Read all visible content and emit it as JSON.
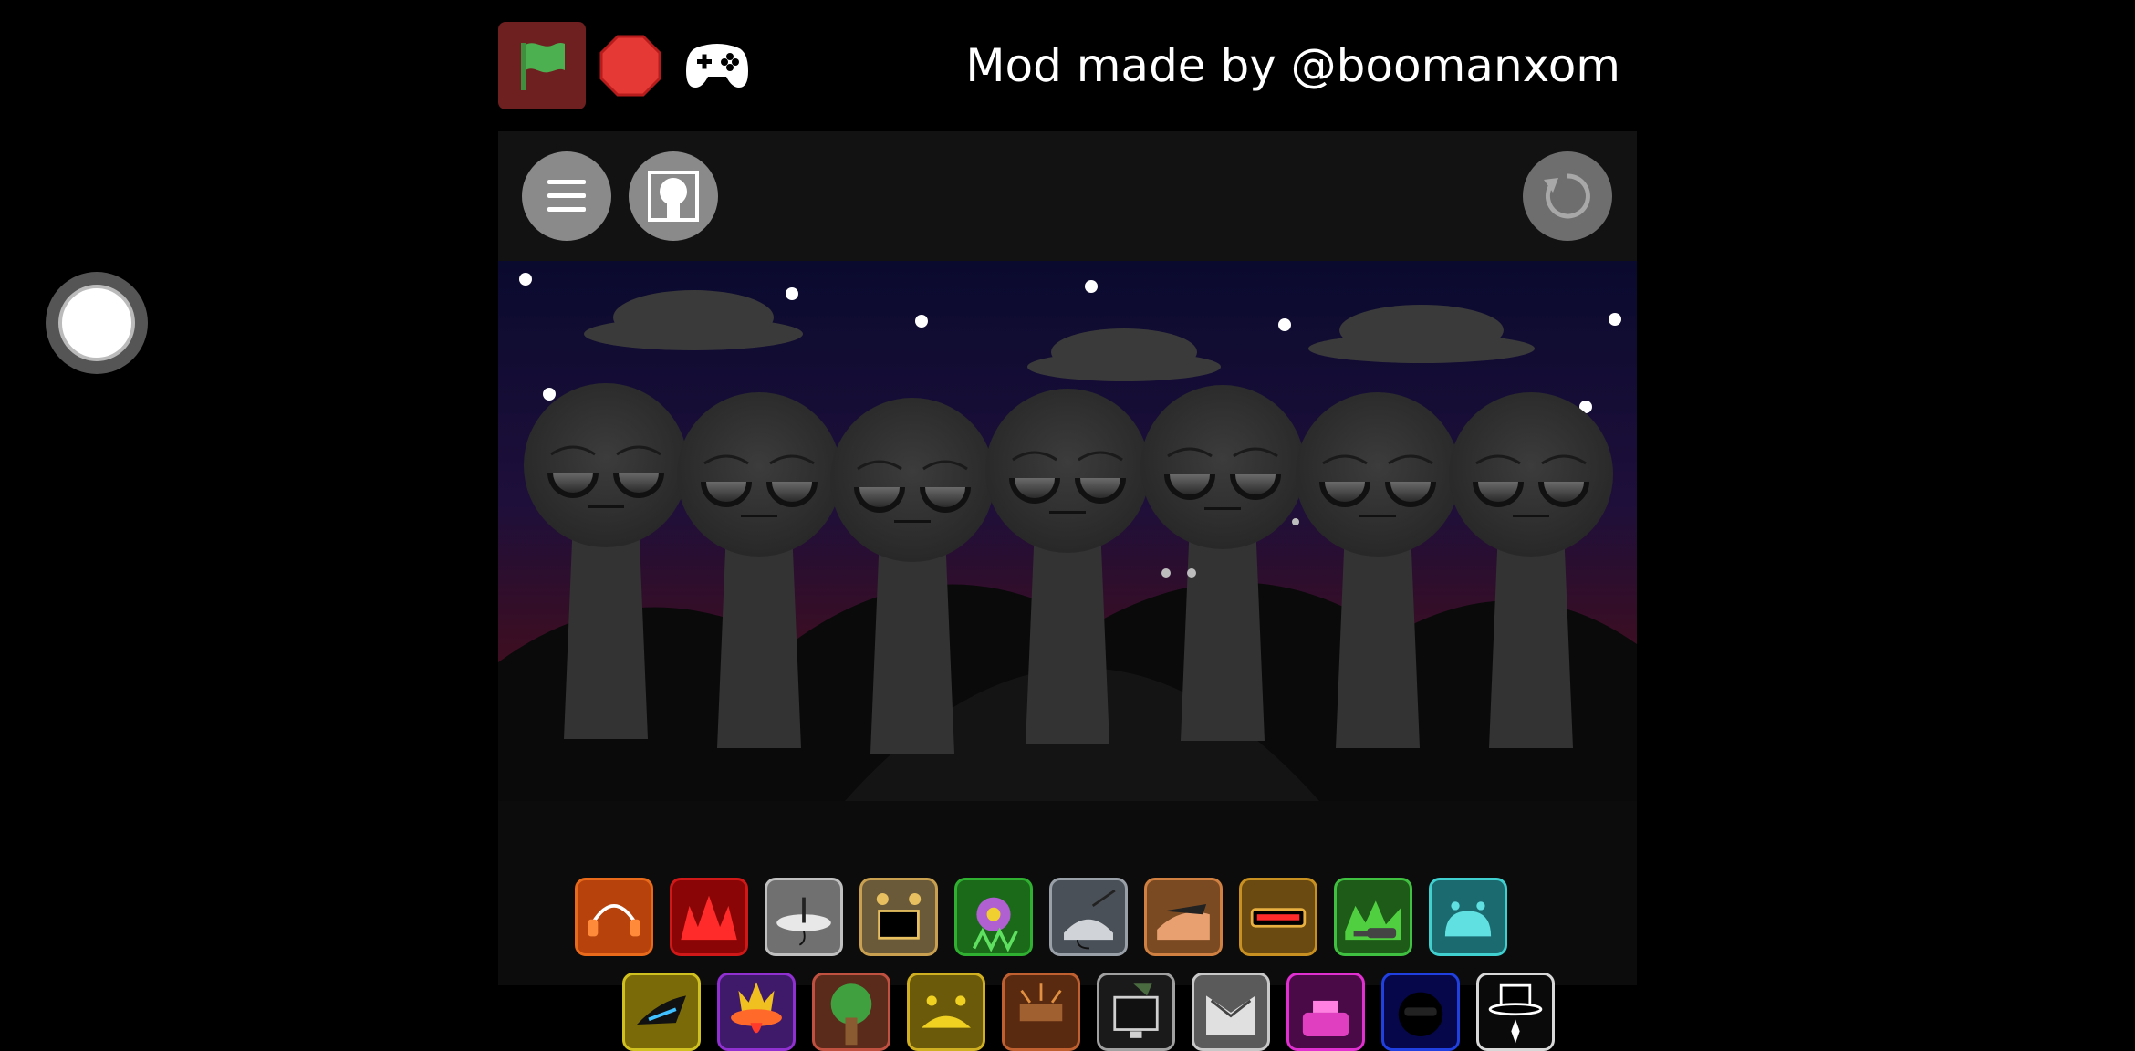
{
  "header": {
    "credit": "Mod made by @boomanxom"
  },
  "icons": {
    "flag": "green-flag-icon",
    "stop": "stop-sign-icon",
    "gamepad": "gamepad-icon",
    "menu": "hamburger-menu-icon",
    "character": "character-select-icon",
    "reset": "reset-icon"
  },
  "colors": {
    "flag_bg": "#6e1f1f",
    "flag": "#4caf50",
    "stop": "#e53935",
    "sky_top": "#0a0a2e",
    "sky_bottom": "#4a0d16"
  },
  "palette_row1": [
    {
      "id": "orange-headphones",
      "border": "#e86a1a",
      "bg": "#b8420c"
    },
    {
      "id": "red-spikes",
      "border": "#d01818",
      "bg": "#8a0606"
    },
    {
      "id": "silver-disc",
      "border": "#c0c0c0",
      "bg": "#707070"
    },
    {
      "id": "gold-monitor",
      "border": "#c8a050",
      "bg": "#6a5a3a"
    },
    {
      "id": "green-flower",
      "border": "#30b030",
      "bg": "#1a6a1a"
    },
    {
      "id": "gray-cat",
      "border": "#9aa0a8",
      "bg": "#4a5058"
    },
    {
      "id": "orange-cap",
      "border": "#d08040",
      "bg": "#7a4a22"
    },
    {
      "id": "gold-visor",
      "border": "#c89020",
      "bg": "#6a4a10"
    },
    {
      "id": "green-gun",
      "border": "#40c040",
      "bg": "#1e5a18"
    },
    {
      "id": "cyan-bell",
      "border": "#40d0d0",
      "bg": "#1a6a70"
    }
  ],
  "palette_row2": [
    {
      "id": "yellow-shark",
      "border": "#d0c020",
      "bg": "#7a6a08"
    },
    {
      "id": "purple-flame",
      "border": "#9030d0",
      "bg": "#401a6a"
    },
    {
      "id": "brown-tree",
      "border": "#c05040",
      "bg": "#5a2a1a"
    },
    {
      "id": "yellow-crown",
      "border": "#d0b020",
      "bg": "#6a5a0a"
    },
    {
      "id": "bronze-sun",
      "border": "#c06030",
      "bg": "#5a2a10"
    },
    {
      "id": "tv-gray",
      "border": "#a0a0a0",
      "bg": "#1a1a1a"
    },
    {
      "id": "silver-wings",
      "border": "#c8c8c8",
      "bg": "#5a5a5a"
    },
    {
      "id": "pink-magenta",
      "border": "#e030d0",
      "bg": "#4a0a48"
    },
    {
      "id": "blue-mask",
      "border": "#2040e0",
      "bg": "#06064a"
    },
    {
      "id": "white-tophat",
      "border": "#d8d8d8",
      "bg": "#0a0a0a"
    }
  ]
}
